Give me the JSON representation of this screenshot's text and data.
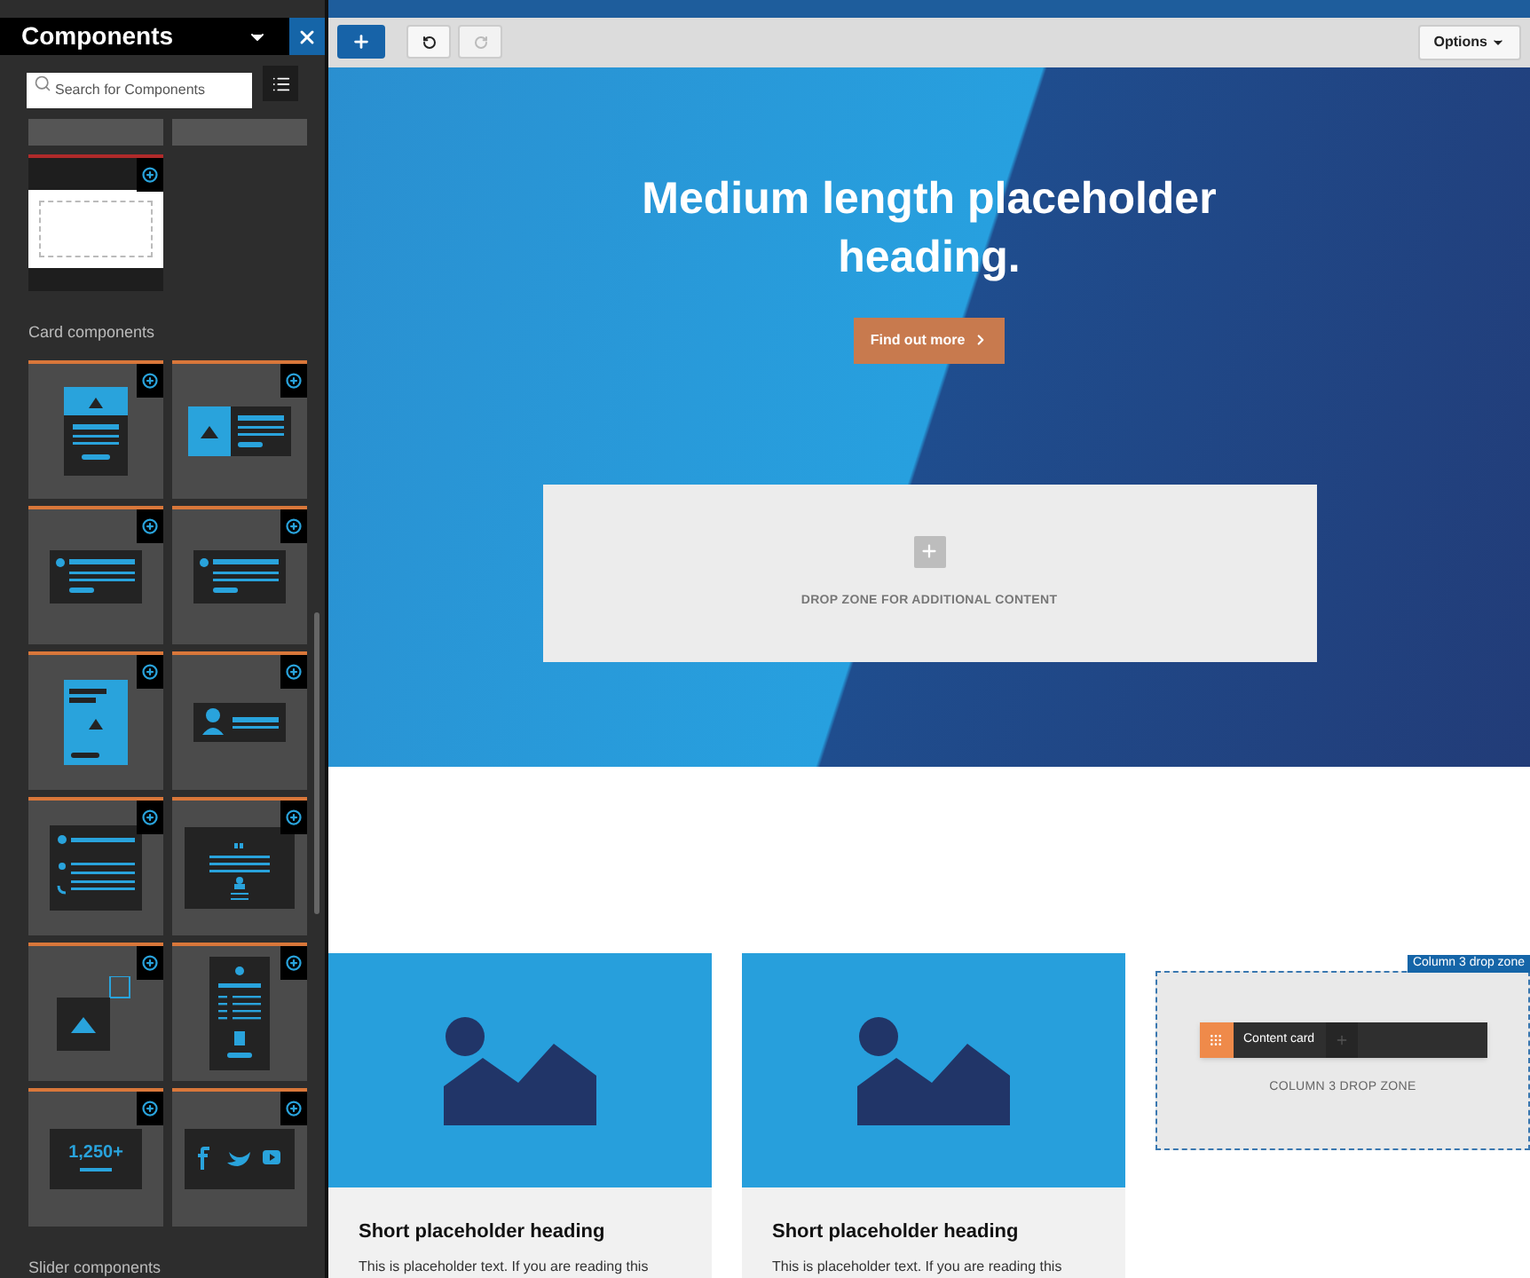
{
  "sidebar": {
    "title": "Components",
    "search": {
      "placeholder": "Search for Components"
    },
    "layout_tiles": [
      {
        "kind": "cut"
      },
      {
        "kind": "cut"
      },
      {
        "kind": "blank-layout"
      }
    ],
    "sections": [
      {
        "heading": "Card components",
        "tiles": [
          {
            "kind": "image-top"
          },
          {
            "kind": "image-left"
          },
          {
            "kind": "list"
          },
          {
            "kind": "list"
          },
          {
            "kind": "tall-image"
          },
          {
            "kind": "profile"
          },
          {
            "kind": "contact"
          },
          {
            "kind": "quote"
          },
          {
            "kind": "image"
          },
          {
            "kind": "pricing"
          },
          {
            "kind": "stat",
            "text": "1,250+"
          },
          {
            "kind": "social"
          }
        ]
      },
      {
        "heading": "Slider components"
      }
    ]
  },
  "toolbar": {
    "buttons": [
      {
        "kind": "add",
        "disabled": false
      },
      {
        "kind": "undo",
        "disabled": false
      },
      {
        "kind": "redo",
        "disabled": true
      }
    ],
    "options": {
      "label": "Options"
    }
  },
  "hero": {
    "heading": "Medium length placeholder heading.",
    "button": "Find out more",
    "drop_zone": "DROP ZONE FOR ADDITIONAL CONTENT"
  },
  "cards": [
    {
      "heading": "Short placeholder heading",
      "text": "This is placeholder text. If you are reading this"
    },
    {
      "heading": "Short placeholder heading",
      "text": "This is placeholder text. If you are reading this"
    }
  ],
  "column_3": {
    "tag": "Column 3 drop zone",
    "chip": "Content card",
    "drop_zone": "COLUMN 3 DROP ZONE"
  }
}
